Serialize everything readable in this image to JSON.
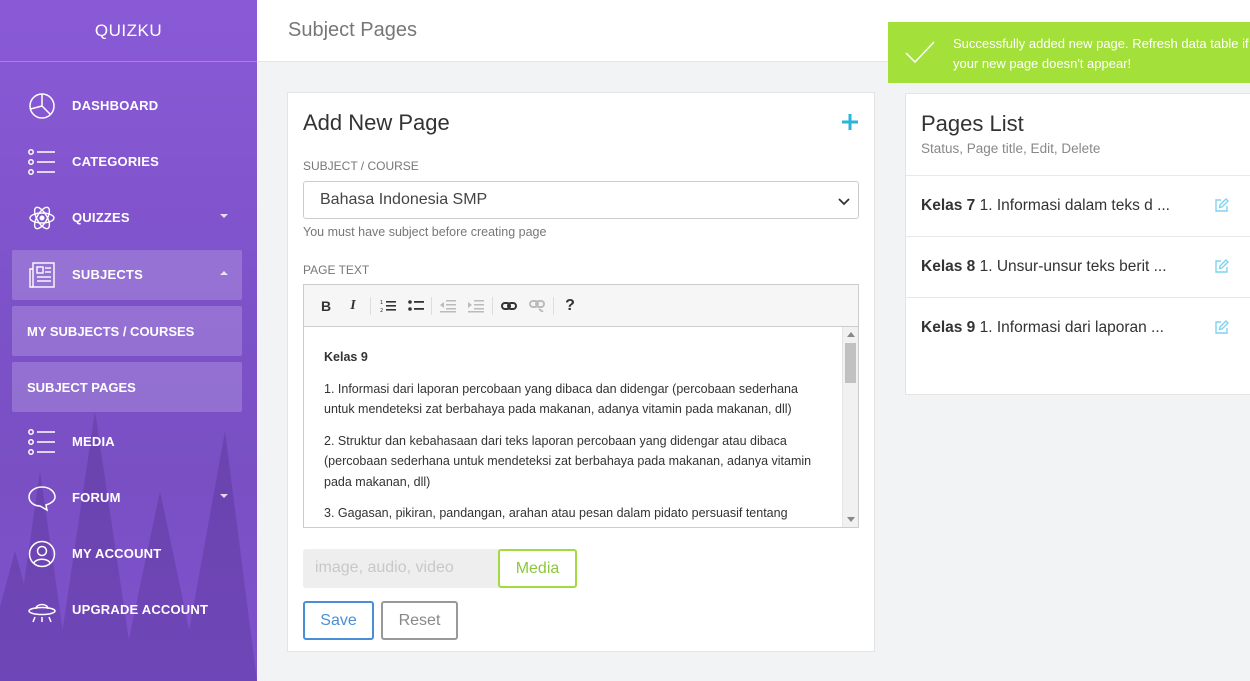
{
  "brand": "QUIZKU",
  "sidebar": {
    "items": [
      {
        "label": "DASHBOARD",
        "icon": "pie-chart-icon"
      },
      {
        "label": "CATEGORIES",
        "icon": "list-icon"
      },
      {
        "label": "QUIZZES",
        "icon": "atom-icon"
      },
      {
        "label": "SUBJECTS",
        "icon": "newspaper-icon"
      },
      {
        "label": "MEDIA",
        "icon": "list-icon"
      },
      {
        "label": "FORUM",
        "icon": "chat-bubble-icon"
      },
      {
        "label": "MY ACCOUNT",
        "icon": "user-circle-icon"
      },
      {
        "label": "UPGRADE ACCOUNT",
        "icon": "ufo-icon"
      }
    ],
    "subitems": [
      "MY SUBJECTS / COURSES",
      "SUBJECT PAGES"
    ]
  },
  "header": {
    "title": "Subject Pages"
  },
  "notification": {
    "line1": "Successfully added new page. Refresh data table if",
    "line2": "your new page doesn't appear!"
  },
  "add_page": {
    "title": "Add New Page",
    "subject_label": "SUBJECT / COURSE",
    "subject_value": "Bahasa Indonesia SMP",
    "subject_help": "You must have subject before creating page",
    "page_text_label": "PAGE TEXT",
    "content": {
      "heading": "Kelas 9",
      "p1": "1. Informasi dari laporan percobaan yang dibaca dan didengar (percobaan sederhana untuk mendeteksi zat berbahaya pada makanan, adanya vitamin pada makanan, dll)",
      "p2": "2. Struktur dan kebahasaan dari teks laporan percobaan yang didengar atau dibaca (percobaan sederhana untuk mendeteksi zat berbahaya pada makanan, adanya vitamin pada makanan, dll)",
      "p3": "3. Gagasan, pikiran, pandangan, arahan atau pesan dalam pidato persuasif tentang"
    },
    "media_placeholder": "image, audio, video",
    "media_button": "Media",
    "save_button": "Save",
    "reset_button": "Reset"
  },
  "pages_list": {
    "title": "Pages List",
    "subtitle": "Status, Page title, Edit, Delete",
    "rows": [
      {
        "kelas": "Kelas 7",
        "text": "1. Informasi dalam teks d ..."
      },
      {
        "kelas": "Kelas 8",
        "text": "1. Unsur-unsur teks berit ..."
      },
      {
        "kelas": "Kelas 9",
        "text": "1. Informasi dari laporan ..."
      }
    ]
  },
  "colors": {
    "sidebar": "#7d52c9",
    "notification": "#a3e03a",
    "accent_blue": "#4a8fd6",
    "media_green": "#8cc63f",
    "plus": "#2bb5d9"
  }
}
